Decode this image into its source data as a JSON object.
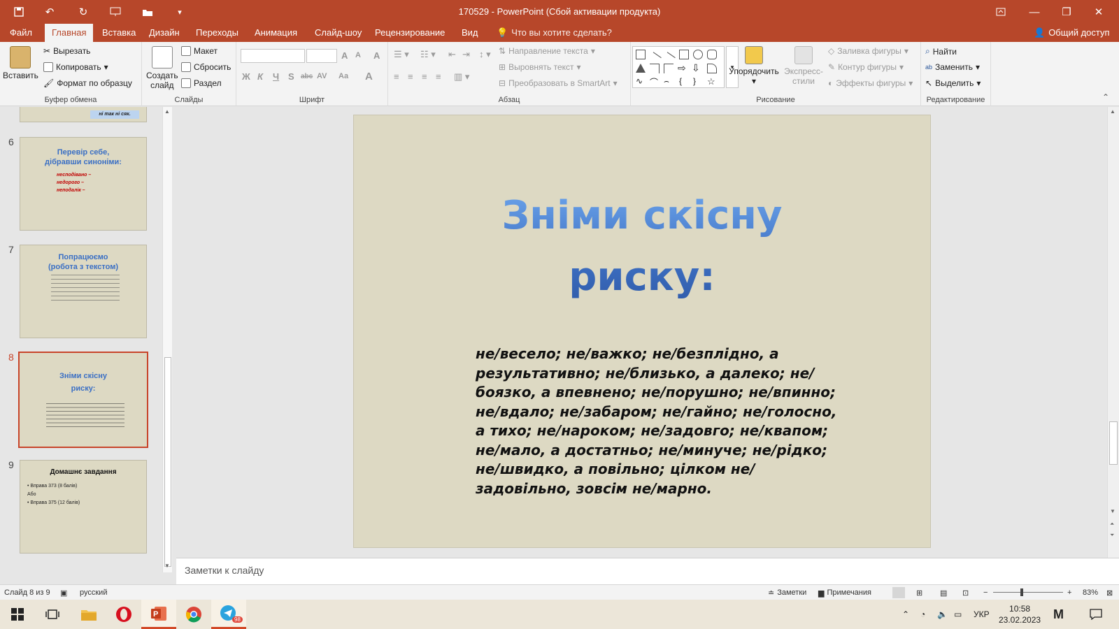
{
  "titlebar": {
    "title": "170529 - PowerPoint (Сбой активации продукта)"
  },
  "tabs": [
    "Файл",
    "Главная",
    "Вставка",
    "Дизайн",
    "Переходы",
    "Анимация",
    "Слайд-шоу",
    "Рецензирование",
    "Вид"
  ],
  "tell_me": "Что вы хотите сделать?",
  "share": "Общий доступ",
  "ribbon": {
    "clipboard": {
      "label": "Буфер обмена",
      "paste": "Вставить",
      "cut": "Вырезать",
      "copy": "Копировать",
      "format_painter": "Формат по образцу"
    },
    "slides": {
      "label": "Слайды",
      "new_slide": "Создать",
      "new_slide_2": "слайд",
      "layout": "Макет",
      "reset": "Сбросить",
      "section": "Раздел"
    },
    "font": {
      "label": "Шрифт",
      "bold": "Ж",
      "italic": "К",
      "underline": "Ч",
      "shadow": "S",
      "strike": "abc",
      "spacing": "AV",
      "case": "Aa",
      "color": "A"
    },
    "paragraph": {
      "label": "Абзац",
      "direction": "Направление текста",
      "align": "Выровнять текст",
      "smartart": "Преобразовать в SmartArt"
    },
    "drawing": {
      "label": "Рисование",
      "arrange": "Упорядочить",
      "styles": "Экспресс-",
      "styles_2": "стили",
      "fill": "Заливка фигуры",
      "outline": "Контур фигуры",
      "effects": "Эффекты фигуры"
    },
    "editing": {
      "label": "Редактирование",
      "find": "Найти",
      "replace": "Заменить",
      "select": "Выделить"
    }
  },
  "thumbnails": [
    {
      "num": "6",
      "title_1": "Перевір себе,",
      "title_2": "дібравши синоніми:",
      "lines": [
        "несподівано –",
        "недорого –",
        "неподалік –"
      ]
    },
    {
      "num": "7",
      "title_1": "Попрацюємо",
      "title_2": "(робота з текстом)"
    },
    {
      "num": "8",
      "title_1": "Зніми скісну",
      "title_2": "риску:"
    },
    {
      "num": "9",
      "title_1": "Домашнє завдання",
      "lines": [
        "Вправа 373 (8 балів)",
        "Або",
        "Вправа 375 (12 балів)"
      ]
    }
  ],
  "thumb_top_fragment": "ні так ні сяк.",
  "slide": {
    "title_line1": "Зніми скісну",
    "title_line2": "риску:",
    "body": "не/весело; не/важко; не/безплідно, а результативно; не/близько, а далеко; не/боязко, а впевнено; не/порушно; не/впинно; не/вдало; не/забаром; не/гайно; не/голосно, а тихо; не/нароком; не/задовго; не/квапом; не/мало, а достатньо; не/минуче;  не/рідко; не/швидко, а повільно; цілком не/задовільно, зовсім не/марно."
  },
  "notes_placeholder": "Заметки к слайду",
  "status": {
    "slide_of": "Слайд 8 из 9",
    "language": "русский",
    "notes": "Заметки",
    "comments": "Примечания",
    "zoom": "83%"
  },
  "taskbar": {
    "lang": "УКР",
    "time": "10:58",
    "date": "23.02.2023",
    "telegram_badge": "98"
  },
  "colors": {
    "accent": "#b7472a",
    "slide_bg": "#ddd9c3",
    "title_blue": "#4f81d4"
  }
}
